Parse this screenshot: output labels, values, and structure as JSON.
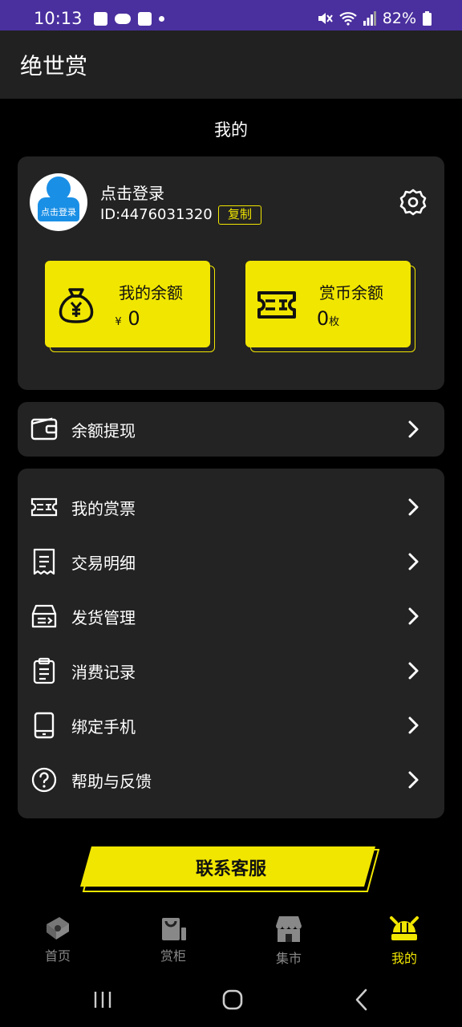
{
  "status_bar": {
    "time": "10:13",
    "battery": "82%"
  },
  "app": {
    "title": "绝世赏"
  },
  "page": {
    "title": "我的"
  },
  "profile": {
    "avatar_label": "点击登录",
    "login_text": "点击登录",
    "id_text": "ID:4476031320",
    "copy_label": "复制"
  },
  "balances": [
    {
      "title": "我的余额",
      "prefix": "¥",
      "value": "0",
      "suffix": ""
    },
    {
      "title": "赏币余额",
      "prefix": "",
      "value": "0",
      "suffix": "枚"
    }
  ],
  "withdraw": {
    "label": "余额提现"
  },
  "menu": [
    {
      "label": "我的赏票",
      "icon": "ticket-icon"
    },
    {
      "label": "交易明细",
      "icon": "receipt-icon"
    },
    {
      "label": "发货管理",
      "icon": "delivery-icon"
    },
    {
      "label": "消费记录",
      "icon": "clipboard-icon"
    },
    {
      "label": "绑定手机",
      "icon": "phone-icon"
    },
    {
      "label": "帮助与反馈",
      "icon": "help-icon"
    }
  ],
  "contact": {
    "label": "联系客服"
  },
  "bottom_nav": [
    {
      "label": "首页",
      "icon": "home-icon",
      "active": false
    },
    {
      "label": "赏柜",
      "icon": "cabinet-icon",
      "active": false
    },
    {
      "label": "集市",
      "icon": "market-icon",
      "active": false
    },
    {
      "label": "我的",
      "icon": "helmet-icon",
      "active": true
    }
  ],
  "colors": {
    "accent": "#f1e600",
    "background": "#000000",
    "card": "#232323",
    "header": "#212121",
    "status_bar": "#4a2f9e"
  }
}
